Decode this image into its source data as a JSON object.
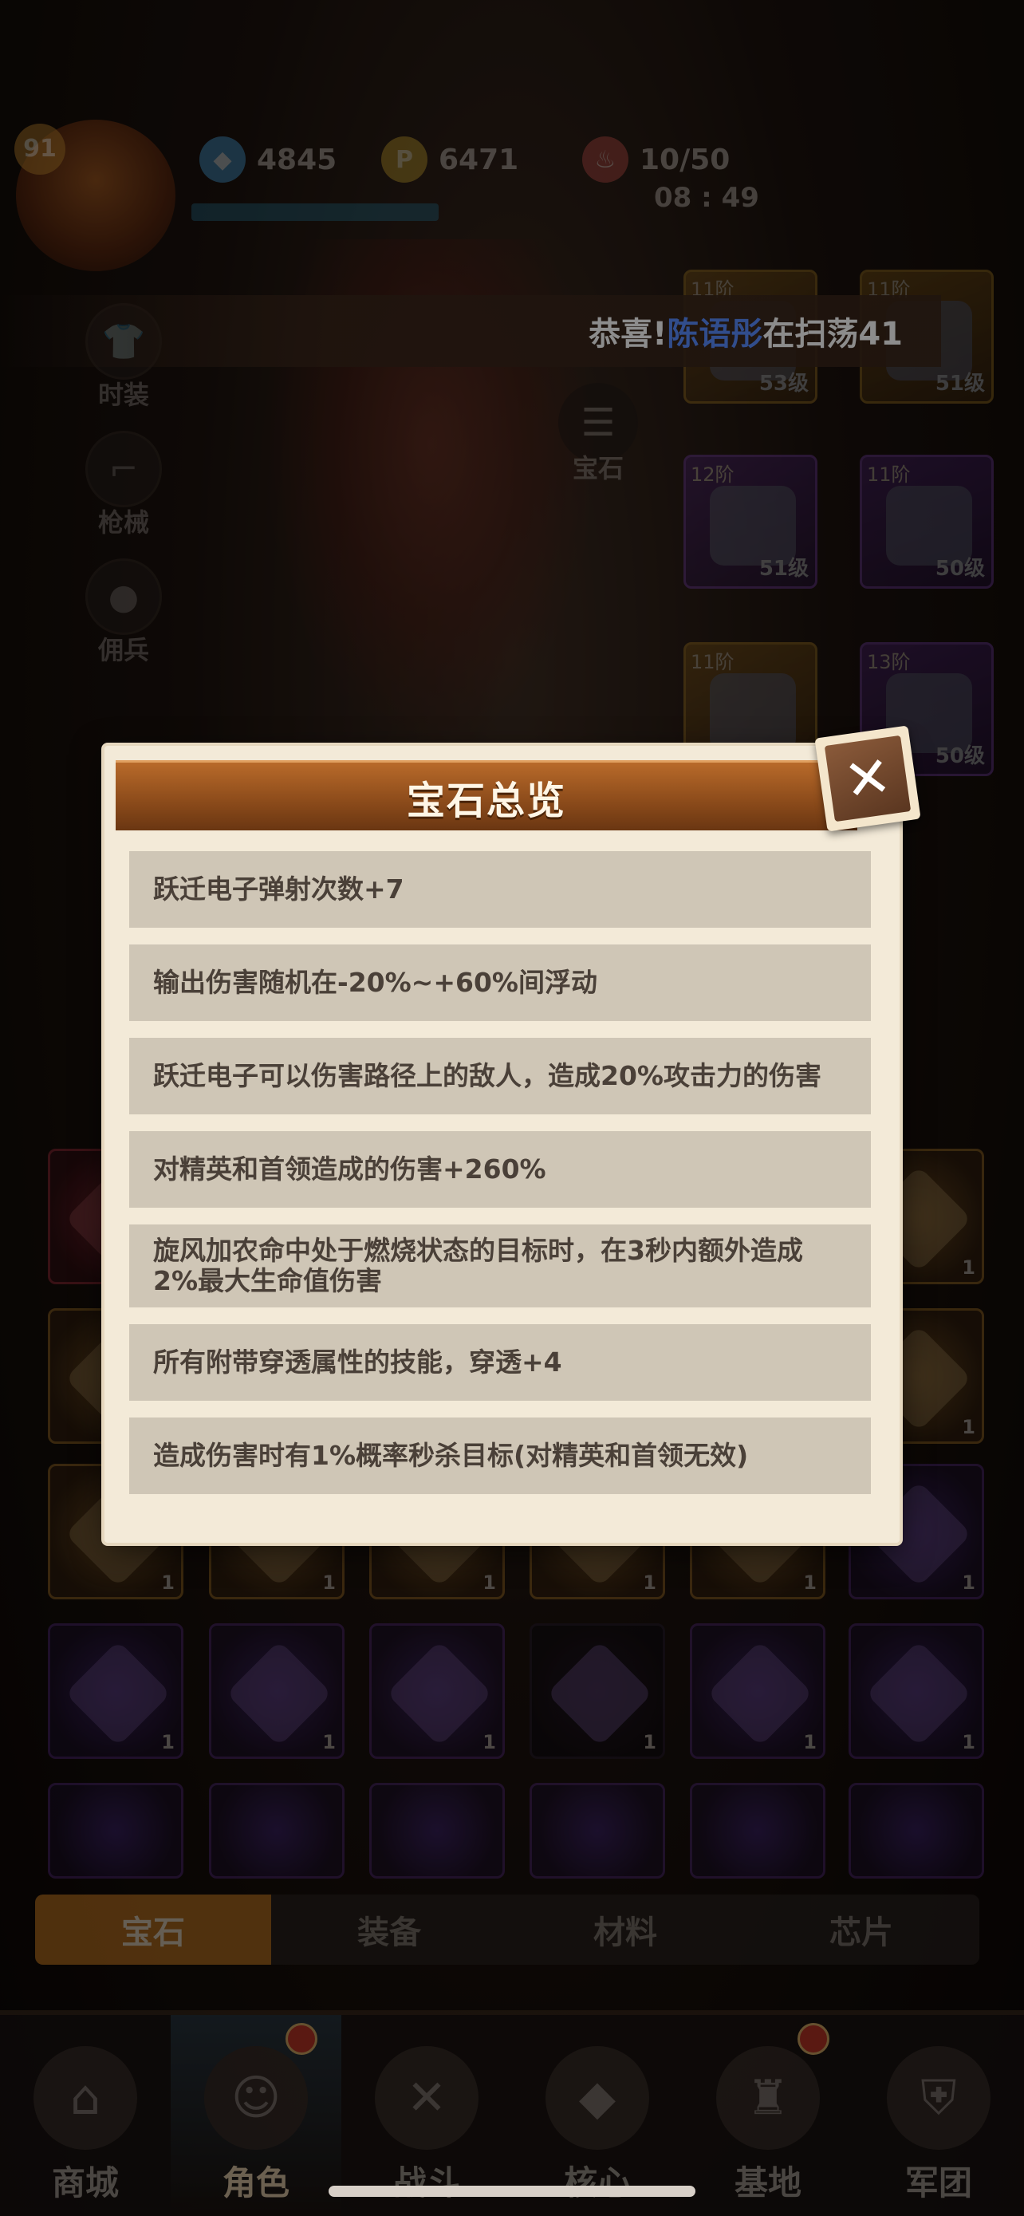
{
  "player": {
    "level": "91"
  },
  "resources": [
    {
      "icon": "diamond-icon",
      "value": "4845"
    },
    {
      "icon": "coin-icon",
      "value": "6471"
    },
    {
      "icon": "meat-stamina-icon",
      "value": "10/50"
    }
  ],
  "timer": "08 : 49",
  "side_menu": [
    "时装",
    "枪械",
    "佣兵"
  ],
  "gem_button": "宝石",
  "ticker": {
    "prefix": "恭喜! ",
    "name": "陈语彤",
    "suffix": "在扫荡41"
  },
  "equipment": [
    {
      "tier": "11阶",
      "level": "53级",
      "rarity": "gold"
    },
    {
      "tier": "11阶",
      "level": "51级",
      "rarity": "gold"
    },
    {
      "tier": "12阶",
      "level": "51级",
      "rarity": "purple"
    },
    {
      "tier": "11阶",
      "level": "50级",
      "rarity": "purple"
    },
    {
      "tier": "11阶",
      "level": "",
      "rarity": "gold"
    },
    {
      "tier": "13阶",
      "level": "50级",
      "rarity": "purple"
    }
  ],
  "modal": {
    "title": "宝石总览",
    "close_icon": "close-icon",
    "effects": [
      "跃迁电子弹射次数+7",
      "输出伤害随机在-20%~+60%间浮动",
      "跃迁电子可以伤害路径上的敌人，造成20%攻击力的伤害",
      "对精英和首领造成的伤害+260%",
      "旋风加农命中处于燃烧状态的目标时，在3秒内额外造成2%最大生命值伤害",
      "所有附带穿透属性的技能，穿透+4",
      "造成伤害时有1%概率秒杀目标(对精英和首领无效)"
    ]
  },
  "category_tabs": [
    "宝石",
    "装备",
    "材料",
    "芯片"
  ],
  "active_category": "宝石",
  "bottom_nav": [
    "商城",
    "角色",
    "战斗",
    "核心",
    "基地",
    "军团"
  ],
  "active_nav": "角色",
  "grid_count": "1"
}
